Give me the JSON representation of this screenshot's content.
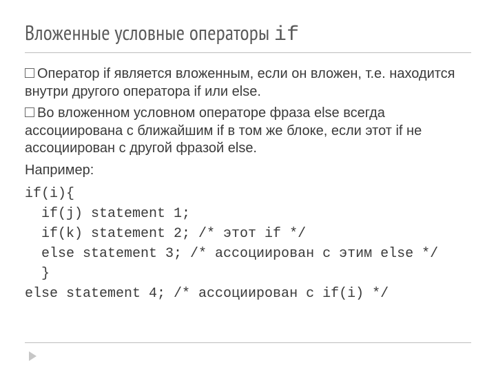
{
  "title_main": "Вложенные условные операторы ",
  "title_code": "if",
  "bullets": [
    "Оператор if является вложенным, если он вложен, т.е. находится внутри другого оператора if или else.",
    "Во вложенном условном операторе фраза else всегда ассоциирована с ближайшим if в том же блоке, если этот if не ассоциирован с другой фразой else."
  ],
  "example_label": "Например:",
  "code_lines": [
    "if(i){",
    "  if(j) statement 1;",
    "  if(k) statement 2; /* этот if */",
    "  else statement 3; /* ассоциирован с этим else */",
    "  }",
    "else statement 4; /* ассоциирован с if(i) */"
  ]
}
